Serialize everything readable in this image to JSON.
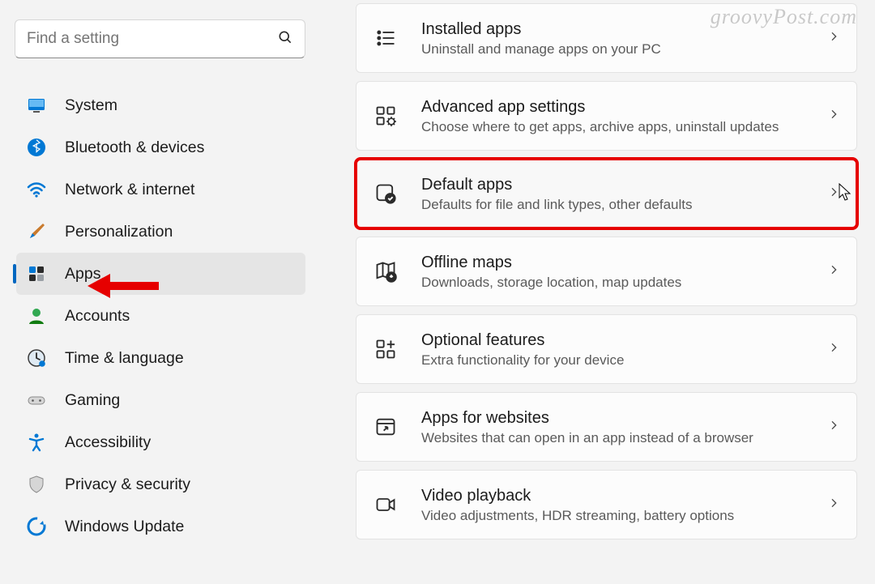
{
  "watermark": "groovyPost.com",
  "search": {
    "placeholder": "Find a setting"
  },
  "sidebar": {
    "items": [
      {
        "label": "System"
      },
      {
        "label": "Bluetooth & devices"
      },
      {
        "label": "Network & internet"
      },
      {
        "label": "Personalization"
      },
      {
        "label": "Apps"
      },
      {
        "label": "Accounts"
      },
      {
        "label": "Time & language"
      },
      {
        "label": "Gaming"
      },
      {
        "label": "Accessibility"
      },
      {
        "label": "Privacy & security"
      },
      {
        "label": "Windows Update"
      }
    ]
  },
  "cards": [
    {
      "title": "Installed apps",
      "sub": "Uninstall and manage apps on your PC"
    },
    {
      "title": "Advanced app settings",
      "sub": "Choose where to get apps, archive apps, uninstall updates"
    },
    {
      "title": "Default apps",
      "sub": "Defaults for file and link types, other defaults"
    },
    {
      "title": "Offline maps",
      "sub": "Downloads, storage location, map updates"
    },
    {
      "title": "Optional features",
      "sub": "Extra functionality for your device"
    },
    {
      "title": "Apps for websites",
      "sub": "Websites that can open in an app instead of a browser"
    },
    {
      "title": "Video playback",
      "sub": "Video adjustments, HDR streaming, battery options"
    }
  ]
}
